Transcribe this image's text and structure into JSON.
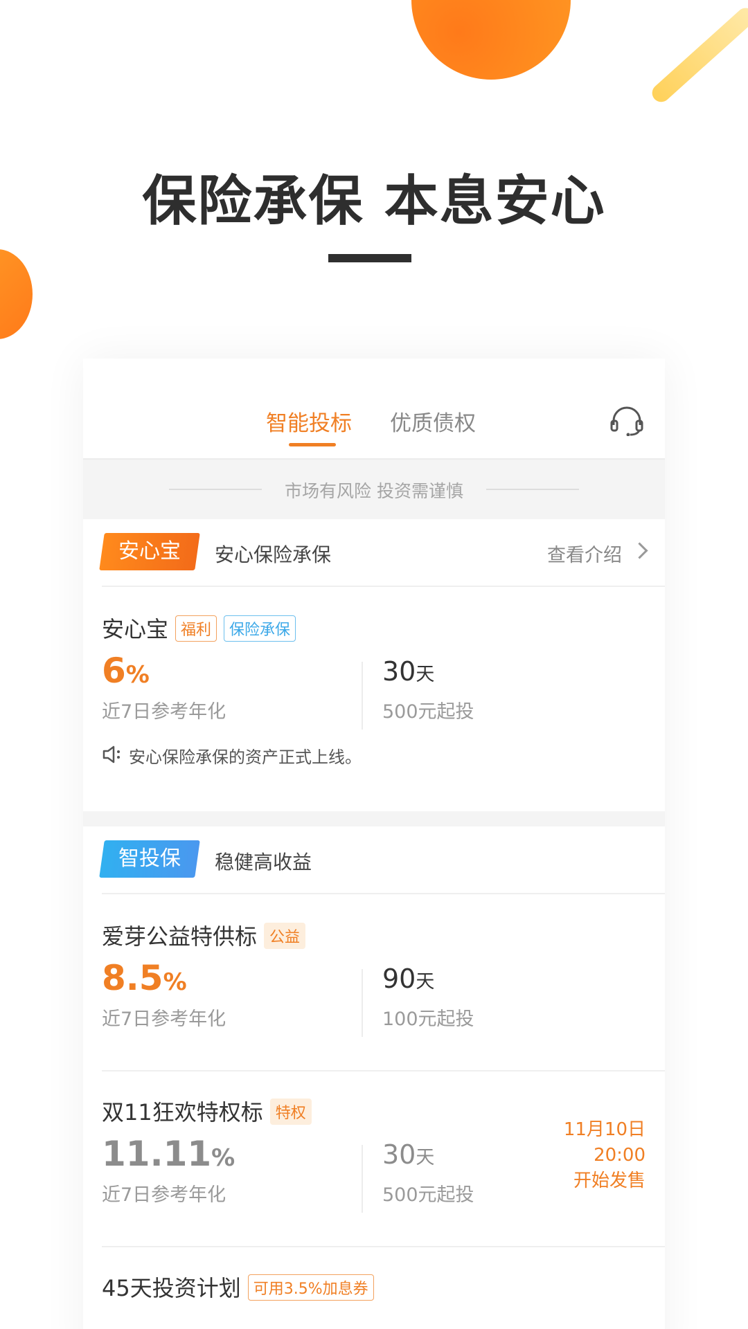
{
  "headline": "保险承保 本息安心",
  "tabs": {
    "active": "智能投标",
    "inactive": "优质债权"
  },
  "icons": {
    "support": "headset-icon",
    "announcement": "speaker-icon",
    "more": "chevron-right-icon"
  },
  "risk_notice": "市场有风险 投资需谨慎",
  "colors": {
    "accent": "#f07f24",
    "blue": "#3da9e8",
    "title": "#2e2e2e"
  },
  "section1": {
    "badge": "安心宝",
    "subtitle": "安心保险承保",
    "more": "查看介绍",
    "product": {
      "name": "安心宝",
      "tags": [
        "福利",
        "保险承保"
      ],
      "rate": "6",
      "rate_unit": "%",
      "rate_label": "近7日参考年化",
      "term": "30",
      "term_unit": "天",
      "min_invest": "500元起投",
      "notice": "安心保险承保的资产正式上线。"
    }
  },
  "section2": {
    "badge": "智投保",
    "subtitle": "稳健高收益",
    "products": [
      {
        "name": "爱芽公益特供标",
        "tag": "公益",
        "rate": "8.5",
        "rate_unit": "%",
        "rate_label": "近7日参考年化",
        "term": "90",
        "term_unit": "天",
        "min_invest": "100元起投"
      },
      {
        "name": "双11狂欢特权标",
        "tag": "特权",
        "rate": "11.11",
        "rate_unit": "%",
        "rate_label": "近7日参考年化",
        "term": "30",
        "term_unit": "天",
        "min_invest": "500元起投",
        "sale_date": "11月10日",
        "sale_time": "20:00",
        "sale_text": "开始发售"
      },
      {
        "name": "45天投资计划",
        "tag": "可用3.5%加息券"
      }
    ]
  }
}
